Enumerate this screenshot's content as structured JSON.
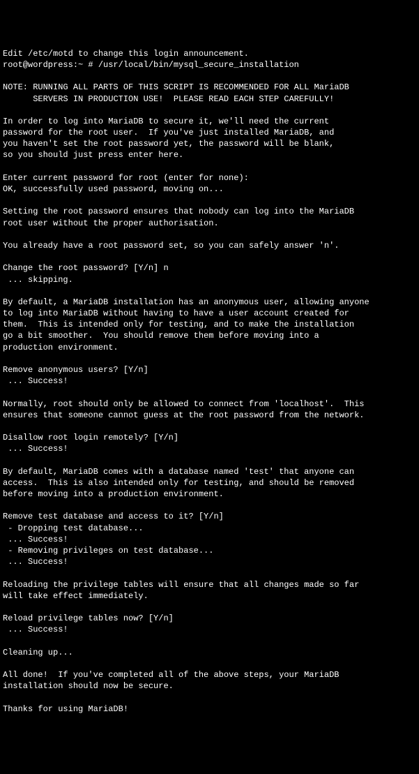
{
  "terminal": {
    "motd": "Edit /etc/motd to change this login announcement.",
    "prompt": "root@wordpress:~ #",
    "command": " /usr/local/bin/mysql_secure_installation",
    "blank1": "",
    "note1": "NOTE: RUNNING ALL PARTS OF THIS SCRIPT IS RECOMMENDED FOR ALL MariaDB",
    "note2": "      SERVERS IN PRODUCTION USE!  PLEASE READ EACH STEP CAREFULLY!",
    "blank2": "",
    "intro1": "In order to log into MariaDB to secure it, we'll need the current",
    "intro2": "password for the root user.  If you've just installed MariaDB, and",
    "intro3": "you haven't set the root password yet, the password will be blank,",
    "intro4": "so you should just press enter here.",
    "blank3": "",
    "enterpw": "Enter current password for root (enter for none):",
    "okpw": "OK, successfully used password, moving on...",
    "blank4": "",
    "setpw1": "Setting the root password ensures that nobody can log into the MariaDB",
    "setpw2": "root user without the proper authorisation.",
    "blank5": "",
    "already": "You already have a root password set, so you can safely answer 'n'.",
    "blank6": "",
    "changepw": "Change the root password? [Y/n] n",
    "skipping": " ... skipping.",
    "blank7": "",
    "anon1": "By default, a MariaDB installation has an anonymous user, allowing anyone",
    "anon2": "to log into MariaDB without having to have a user account created for",
    "anon3": "them.  This is intended only for testing, and to make the installation",
    "anon4": "go a bit smoother.  You should remove them before moving into a",
    "anon5": "production environment.",
    "blank8": "",
    "removeanon": "Remove anonymous users? [Y/n]",
    "success1": " ... Success!",
    "blank9": "",
    "normally1": "Normally, root should only be allowed to connect from 'localhost'.  This",
    "normally2": "ensures that someone cannot guess at the root password from the network.",
    "blank10": "",
    "disallow": "Disallow root login remotely? [Y/n]",
    "success2": " ... Success!",
    "blank11": "",
    "testdb1": "By default, MariaDB comes with a database named 'test' that anyone can",
    "testdb2": "access.  This is also intended only for testing, and should be removed",
    "testdb3": "before moving into a production environment.",
    "blank12": "",
    "removetest": "Remove test database and access to it? [Y/n]",
    "dropping": " - Dropping test database...",
    "success3": " ... Success!",
    "removing": " - Removing privileges on test database...",
    "success4": " ... Success!",
    "blank13": "",
    "reload1": "Reloading the privilege tables will ensure that all changes made so far",
    "reload2": "will take effect immediately.",
    "blank14": "",
    "reloadq": "Reload privilege tables now? [Y/n]",
    "success5": " ... Success!",
    "blank15": "",
    "cleaning": "Cleaning up...",
    "blank16": "",
    "alldone1": "All done!  If you've completed all of the above steps, your MariaDB",
    "alldone2": "installation should now be secure.",
    "blank17": "",
    "thanks": "Thanks for using MariaDB!"
  }
}
